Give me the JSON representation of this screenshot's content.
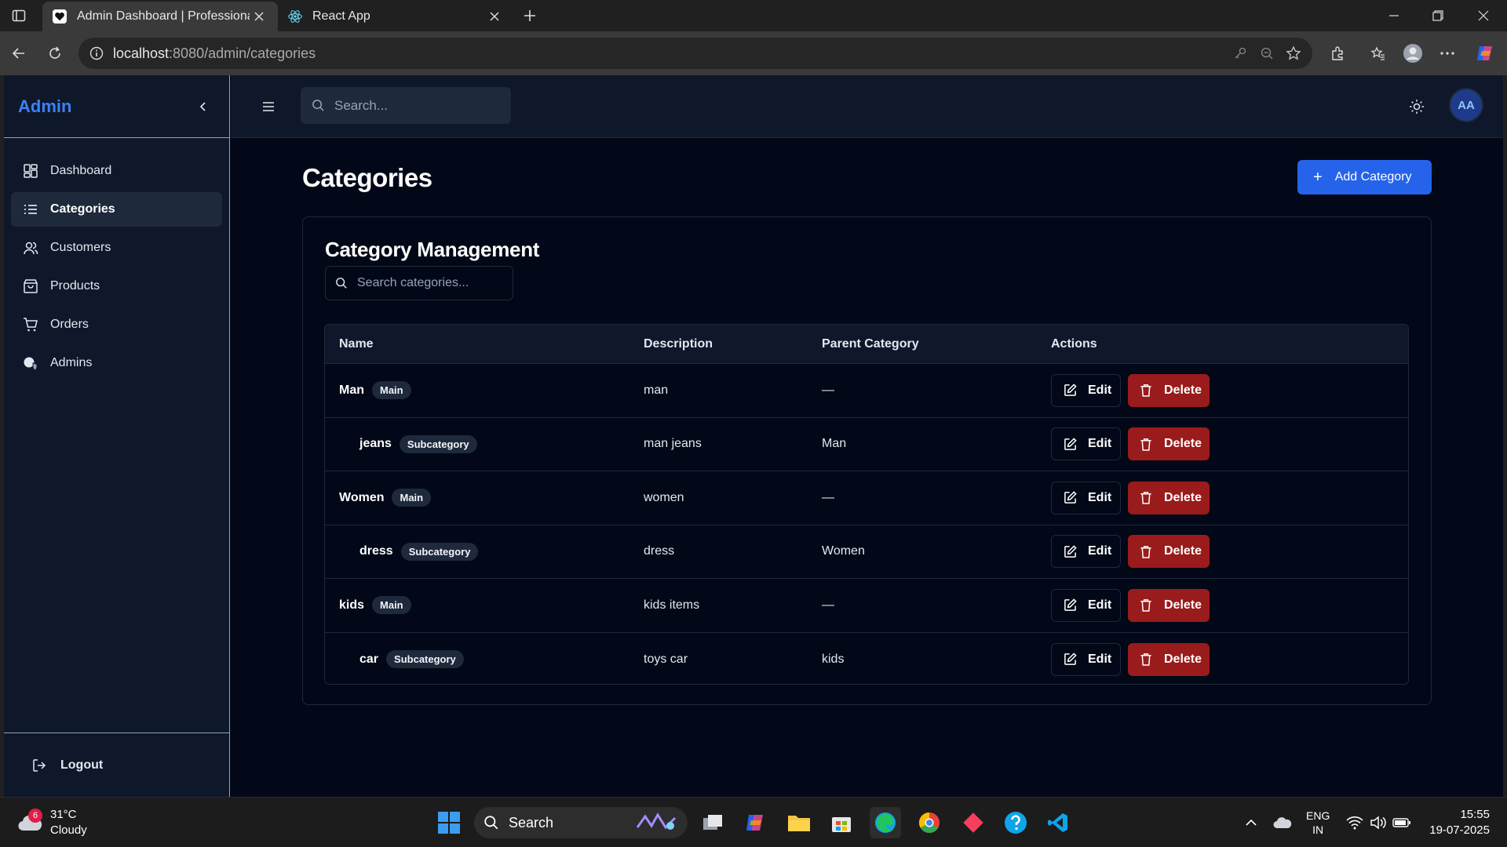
{
  "browser": {
    "tabs": [
      {
        "title": "Admin Dashboard | Professional M",
        "active": true
      },
      {
        "title": "React App",
        "active": false
      }
    ],
    "url_host": "localhost",
    "url_path": ":8080/admin/categories"
  },
  "sidebar": {
    "brand": "Admin",
    "items": [
      {
        "label": "Dashboard",
        "icon": "dashboard-icon",
        "active": false
      },
      {
        "label": "Categories",
        "icon": "list-icon",
        "active": true
      },
      {
        "label": "Customers",
        "icon": "users-icon",
        "active": false
      },
      {
        "label": "Products",
        "icon": "bag-icon",
        "active": false
      },
      {
        "label": "Orders",
        "icon": "cart-icon",
        "active": false
      },
      {
        "label": "Admins",
        "icon": "shield-icon",
        "active": false
      }
    ],
    "logout": "Logout"
  },
  "topbar": {
    "search_placeholder": "Search...",
    "avatar": "AA"
  },
  "page": {
    "title": "Categories",
    "add_button": "Add Category"
  },
  "card": {
    "title": "Category Management",
    "search_placeholder": "Search categories..."
  },
  "table": {
    "headers": [
      "Name",
      "Description",
      "Parent Category",
      "Actions"
    ],
    "rows": [
      {
        "name": "Man",
        "badge": "Main",
        "description": "man",
        "parent": "—",
        "sub": false
      },
      {
        "name": "jeans",
        "badge": "Subcategory",
        "description": "man jeans",
        "parent": "Man",
        "sub": true
      },
      {
        "name": "Women",
        "badge": "Main",
        "description": "women",
        "parent": "—",
        "sub": false
      },
      {
        "name": "dress",
        "badge": "Subcategory",
        "description": "dress",
        "parent": "Women",
        "sub": true
      },
      {
        "name": "kids",
        "badge": "Main",
        "description": "kids items",
        "parent": "—",
        "sub": false
      },
      {
        "name": "car",
        "badge": "Subcategory",
        "description": "toys car",
        "parent": "kids",
        "sub": true
      }
    ],
    "edit_label": "Edit",
    "delete_label": "Delete"
  },
  "taskbar": {
    "weather_badge": "6",
    "temperature": "31°C",
    "condition": "Cloudy",
    "search_label": "Search",
    "lang": "ENG",
    "region": "IN",
    "time": "15:55",
    "date": "19-07-2025"
  },
  "colors": {
    "accent": "#2563eb",
    "brand": "#3b82f6",
    "danger": "#991b1b",
    "background": "#020817",
    "panel": "#0f172a"
  }
}
